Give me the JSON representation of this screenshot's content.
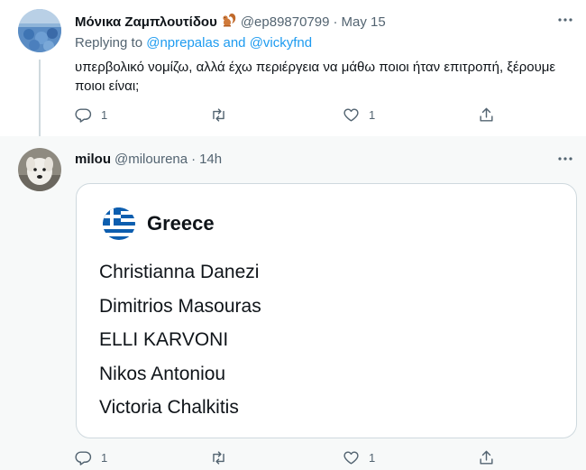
{
  "tweets": [
    {
      "name": "Μόνικα Ζαμπλουτίδου",
      "name_emoji": "squirrel",
      "handle": "@ep89870799",
      "dot": "·",
      "time": "May 15",
      "replying_prefix": "Replying to",
      "replying_users": "@nprepalas and @vickyfnd",
      "text": "υπερβολικό νομίζω, αλλά έχω περιέργεια να μάθω ποιοι ήταν επιτροπή, ξέρουμε ποιοι είναι;",
      "reply_count": "1",
      "retweet_count": "",
      "like_count": "1"
    },
    {
      "name": "milou",
      "handle": "@milourena",
      "dot": "·",
      "time": "14h",
      "card": {
        "flag": "greece-flag",
        "title": "Greece",
        "names": [
          "Christianna Danezi",
          "Dimitrios Masouras",
          "ELLI KARVONI",
          "Nikos Antoniou",
          "Victoria Chalkitis"
        ]
      },
      "reply_count": "1",
      "retweet_count": "",
      "like_count": "1"
    }
  ],
  "colors": {
    "link": "#1d9bf0",
    "secondary_text": "#536471",
    "highlight_bg": "#f7f9f9",
    "border": "#cfd9de",
    "flag_blue": "#0d5eaf"
  }
}
